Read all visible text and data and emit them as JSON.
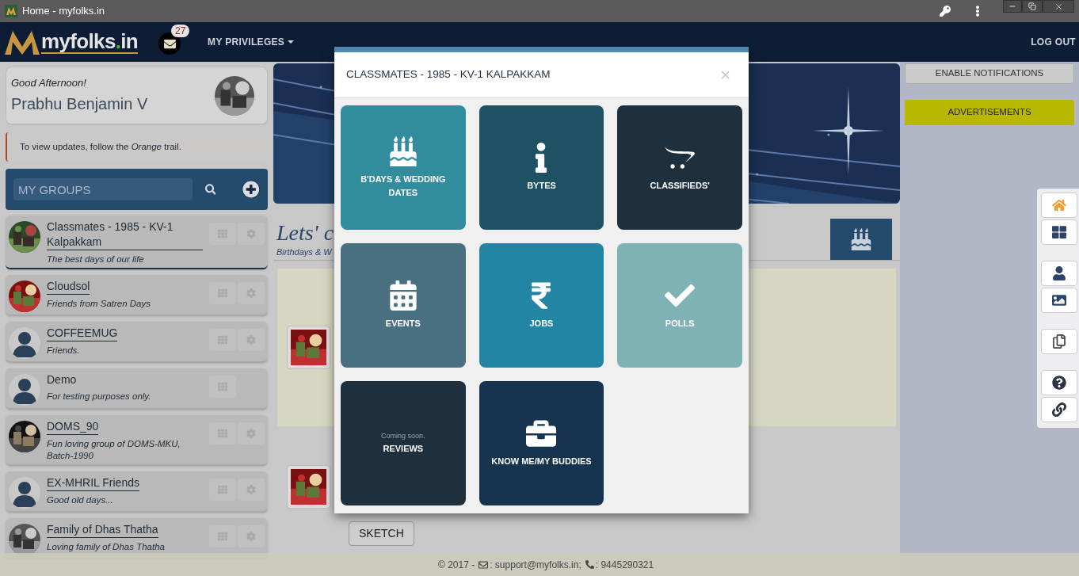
{
  "window": {
    "title": "Home - myfolks.in"
  },
  "navbar": {
    "logo": {
      "name": "myfolks",
      "dot": ".",
      "suffix": "in"
    },
    "mail_count": "27",
    "menu": "MY PRIVILEGES",
    "logout": "LOG OUT"
  },
  "greeting": {
    "salutation": "Good Afternoon!",
    "name": "Prabhu Benjamin V"
  },
  "tip": "To view updates, follow the *Orange* trail.",
  "groups_panel": {
    "placeholder": "MY GROUPS"
  },
  "groups": [
    {
      "name": "Classmates - 1985 - KV-1 Kalpakkam",
      "tagline": "The best days of our life",
      "selected": true,
      "link": true,
      "settings": true
    },
    {
      "name": "Cloudsol",
      "tagline": "Friends from Satren Days",
      "selected": false,
      "link": true,
      "settings": true
    },
    {
      "name": "COFFEEMUG",
      "tagline": "Friends.",
      "kind": "person",
      "selected": false,
      "link": true,
      "settings": true
    },
    {
      "name": "Demo",
      "tagline": "For testing purposes only.",
      "kind": "person",
      "selected": false,
      "link": false,
      "settings": false
    },
    {
      "name": "DOMS_90",
      "tagline": "Fun loving group of DOMS-MKU, Batch-1990",
      "selected": false,
      "link": true,
      "settings": true
    },
    {
      "name": "EX-MHRIL Friends",
      "tagline": "Good old days...",
      "kind": "person",
      "selected": false,
      "link": true,
      "settings": true
    },
    {
      "name": "Family of Dhas Thatha",
      "tagline": "Loving family of Dhas Thatha",
      "selected": false,
      "link": true,
      "settings": true
    }
  ],
  "main": {
    "heading": "Lets' c",
    "subheading": "Birthdays & W",
    "sketch_button": "SKETCH"
  },
  "modal": {
    "title": "CLASSMATES - 1985 - KV-1 KALPAKKAM",
    "close": "×",
    "tiles": [
      {
        "kind": "cake",
        "label": "B'DAYS & WEDDING DATES",
        "color": "#318d9e"
      },
      {
        "kind": "info",
        "label": "BYTES",
        "color": "#1e5163"
      },
      {
        "kind": "cart",
        "label": "CLASSIFIEDS'",
        "color": "#1e2f3e"
      },
      {
        "kind": "calendar",
        "label": "EVENTS",
        "color": "#4a6f80"
      },
      {
        "kind": "rupee",
        "label": "JOBS",
        "color": "#2285a4"
      },
      {
        "kind": "check",
        "label": "POLLS",
        "color": "#7fb2b4"
      },
      {
        "kind": "soon",
        "note": "Coming soon.",
        "label": "REVIEWS",
        "color": "#1e2f3e"
      },
      {
        "kind": "briefcase",
        "label": "KNOW ME/MY BUDDIES",
        "color": "#16344f"
      }
    ]
  },
  "right": {
    "notifications": "ENABLE NOTIFICATIONS",
    "ads": "ADVERTISEMENTS"
  },
  "footer": {
    "year": "© 2017 -",
    "email": ": support@myfolks.in;",
    "phone": ": 9445290321"
  }
}
